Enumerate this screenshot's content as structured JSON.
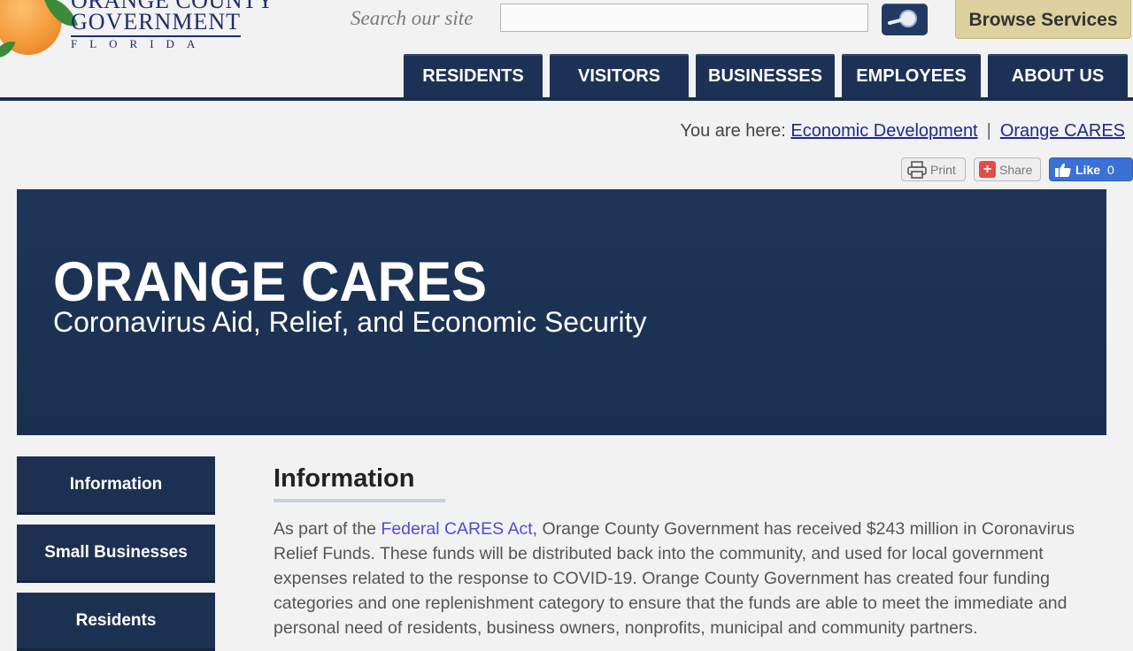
{
  "logo": {
    "line1": "ORANGE COUNTY",
    "line2": "GOVERNMENT",
    "line3": "FLORIDA"
  },
  "search": {
    "label": "Search our site",
    "value": "",
    "placeholder": ""
  },
  "browse_services": "Browse Services",
  "nav": {
    "items": [
      {
        "label": "RESIDENTS"
      },
      {
        "label": "VISITORS"
      },
      {
        "label": "BUSINESSES"
      },
      {
        "label": "EMPLOYEES"
      },
      {
        "label": "ABOUT US"
      }
    ]
  },
  "breadcrumb": {
    "prefix": "You are here:",
    "items": [
      "Economic Development",
      "Orange CARES"
    ],
    "separator": "|"
  },
  "tools": {
    "print": "Print",
    "share": "Share",
    "like": "Like",
    "like_count": "0"
  },
  "hero": {
    "title": "ORANGE CARES",
    "subtitle": "Coronavirus Aid, Relief, and Economic Security"
  },
  "sidebar": {
    "items": [
      {
        "label": "Information"
      },
      {
        "label": "Small Businesses"
      },
      {
        "label": "Residents"
      }
    ]
  },
  "main": {
    "heading": "Information",
    "paragraph_before_link": "As part of the ",
    "link_text": "Federal CARES Act",
    "paragraph_after_link": ", Orange County Government has received $243 million in Coronavirus Relief Funds. These funds will be distributed back into the community, and used for local government expenses related to the response to COVID-19. Orange County Government has created four funding categories and one replenishment category to ensure that the funds are able to meet the immediate and personal need of residents, business owners, nonprofits, municipal and community partners."
  },
  "colors": {
    "navy": "#1c3152",
    "browse_gold": "#ddd1a0",
    "link_blue": "#4b4fd1",
    "like_blue": "#3b70d4"
  }
}
